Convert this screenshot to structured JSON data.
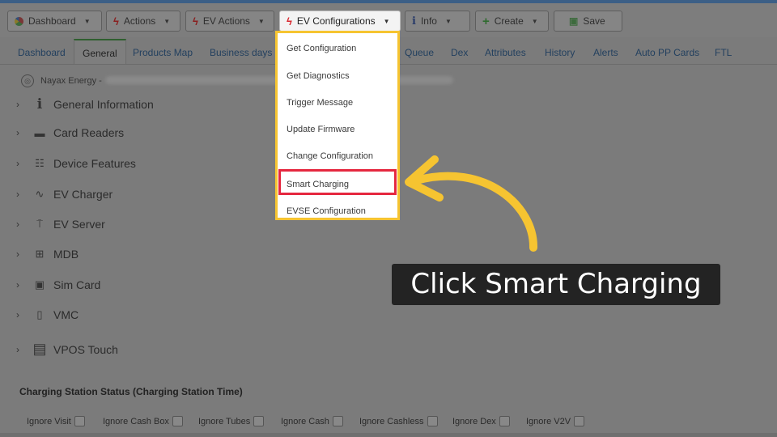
{
  "toolbar": {
    "buttons": [
      {
        "label": "Dashboard",
        "icon": "pie-chart-icon",
        "has_caret": true
      },
      {
        "label": "Actions",
        "icon": "lightning-icon",
        "has_caret": true
      },
      {
        "label": "EV Actions",
        "icon": "lightning-icon",
        "has_caret": true
      },
      {
        "label": "EV Configurations",
        "icon": "lightning-icon",
        "has_caret": true,
        "active": true
      },
      {
        "label": "Info",
        "icon": "info-icon",
        "has_caret": true
      },
      {
        "label": "Create",
        "icon": "plus-icon",
        "has_caret": true
      },
      {
        "label": "Save",
        "icon": "save-icon",
        "has_caret": false
      }
    ]
  },
  "tabs": [
    "Dashboard",
    "General",
    "Products Map",
    "Business days",
    "Queue",
    "Dex",
    "Attributes",
    "History",
    "Alerts",
    "Auto PP Cards",
    "FTL"
  ],
  "active_tab": "General",
  "org": {
    "name": "Nayax Energy -"
  },
  "sections": [
    {
      "label": "General Information",
      "icon": "info-icon"
    },
    {
      "label": "Card Readers",
      "icon": "card-reader-icon"
    },
    {
      "label": "Device Features",
      "icon": "features-icon"
    },
    {
      "label": "EV Charger",
      "icon": "pulse-icon"
    },
    {
      "label": "EV Server",
      "icon": "antenna-icon"
    },
    {
      "label": "MDB",
      "icon": "mdb-icon"
    },
    {
      "label": "Sim Card",
      "icon": "sim-card-icon"
    },
    {
      "label": "VMC",
      "icon": "vmc-icon"
    },
    {
      "label": "VPOS Touch",
      "icon": "vpos-touch-icon"
    }
  ],
  "status": {
    "title": "Charging Station Status (Charging Station Time)",
    "checkboxes": [
      "Ignore Visit",
      "Ignore Cash Box",
      "Ignore Tubes",
      "Ignore Cash",
      "Ignore Cashless",
      "Ignore Dex",
      "Ignore V2V"
    ]
  },
  "dropdown": {
    "items": [
      "Get Configuration",
      "Get Diagnostics",
      "Trigger Message",
      "Update Firmware",
      "Change Configuration",
      "Smart Charging",
      "EVSE Configuration"
    ],
    "highlighted": "Smart Charging"
  },
  "callout": {
    "text": "Click Smart Charging"
  },
  "colors": {
    "highlight_border": "#f6c431",
    "target_border": "#e5273f",
    "arrow": "#f6c431",
    "callout_bg": "#232323"
  }
}
